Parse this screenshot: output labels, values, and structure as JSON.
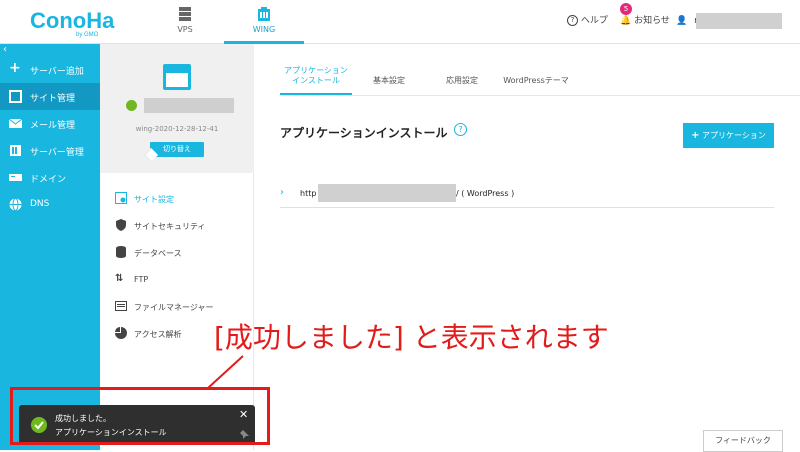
{
  "header": {
    "logo_text": "ConoHa by GMO",
    "tabs": [
      {
        "label": "VPS",
        "icon": "server-icon"
      },
      {
        "label": "WING",
        "icon": "building-icon"
      }
    ],
    "help_label": "ヘルプ",
    "notice_label": "お知らせ",
    "notice_count": "5",
    "user_initial": "r"
  },
  "sidebar": {
    "collapse_glyph": "‹",
    "items": [
      {
        "label": "サーバー追加",
        "icon": "plus-icon"
      },
      {
        "label": "サイト管理",
        "icon": "window-icon"
      },
      {
        "label": "メール管理",
        "icon": "mail-icon"
      },
      {
        "label": "サーバー管理",
        "icon": "server-icon"
      },
      {
        "label": "ドメイン",
        "icon": "domain-icon"
      },
      {
        "label": "DNS",
        "icon": "globe-icon"
      }
    ]
  },
  "site": {
    "id": "wing-2020-12-28-12-41",
    "switch_label": "切り替え",
    "menu": [
      {
        "label": "サイト設定",
        "icon": "site-settings-icon"
      },
      {
        "label": "サイトセキュリティ",
        "icon": "shield-icon"
      },
      {
        "label": "データベース",
        "icon": "database-icon"
      },
      {
        "label": "FTP",
        "icon": "ftp-icon"
      },
      {
        "label": "ファイルマネージャー",
        "icon": "folder-icon"
      },
      {
        "label": "アクセス解析",
        "icon": "pie-chart-icon"
      }
    ]
  },
  "main": {
    "tabs": [
      {
        "line1": "アプリケーション",
        "line2": "インストール"
      },
      {
        "line1": "基本設定",
        "line2": ""
      },
      {
        "line1": "応用設定",
        "line2": ""
      },
      {
        "line1": "WordPressテーマ",
        "line2": ""
      }
    ],
    "section_title": "アプリケーションインストール",
    "add_button_label": "アプリケーション",
    "app_row": {
      "url_prefix": "http",
      "url_suffix": "/ ( WordPress )"
    },
    "feedback_label": "フィードバック"
  },
  "annotation": "[成功しました] と表示されます",
  "toast": {
    "title": "成功しました。",
    "message": "アプリケーションインストール"
  },
  "colors": {
    "accent": "#19b6e0",
    "sidebar_active": "#1298c2",
    "annotation_red": "#e31b1b",
    "success_green": "#6fb81f",
    "badge_pink": "#e4287a"
  }
}
